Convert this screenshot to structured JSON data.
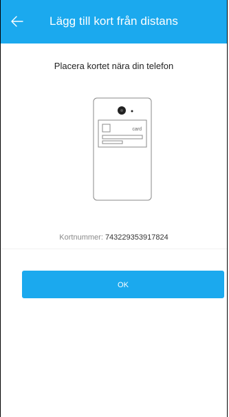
{
  "header": {
    "title": "Lägg till kort från distans",
    "back_icon": "arrow-left-icon"
  },
  "main": {
    "instruction": "Placera kortet nära din telefon",
    "illustration": {
      "icon": "phone-with-card-icon",
      "card_label": "card"
    },
    "card_number_label": "Kortnummer:",
    "card_number_value": "743229353917824",
    "ok_label": "OK"
  },
  "colors": {
    "accent": "#1ba9ee",
    "header_text": "#ffffff",
    "muted_text": "#8a8a8a"
  }
}
